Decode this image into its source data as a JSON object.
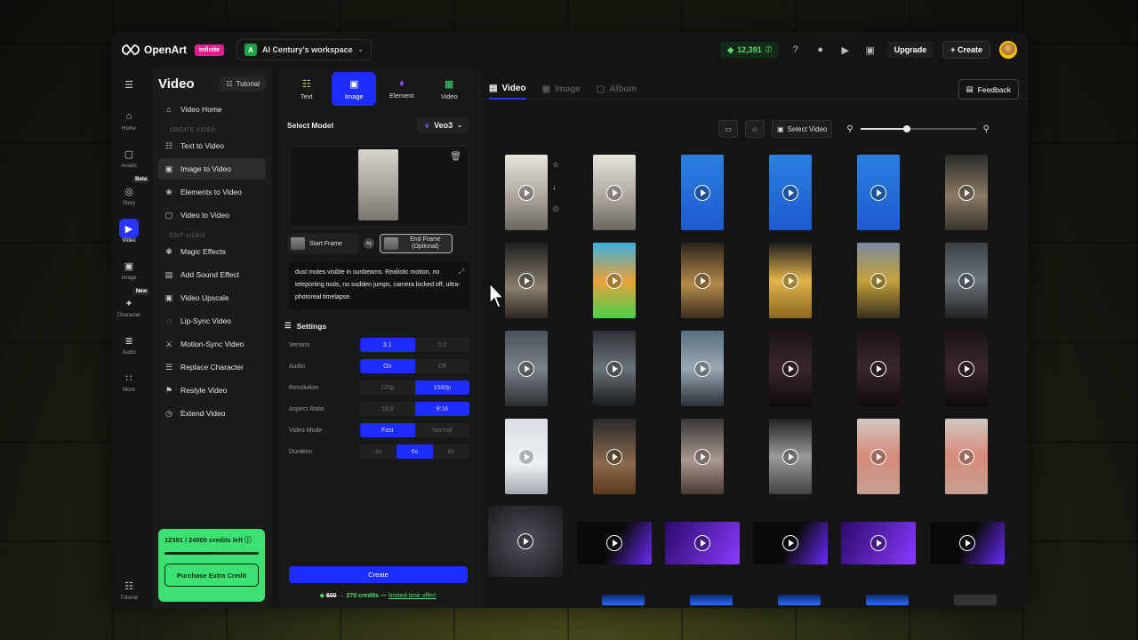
{
  "topbar": {
    "brand": "OpenArt",
    "plan_badge": "Infinite",
    "workspace_initial": "A",
    "workspace": "AI Century's workspace",
    "credits": "12,391",
    "upgrade": "Upgrade",
    "create": "Create"
  },
  "rail": [
    {
      "label": "Home",
      "icon": "home-icon"
    },
    {
      "label": "Assets",
      "icon": "folder-icon"
    },
    {
      "label": "Story",
      "icon": "story-icon",
      "badge": "Beta"
    },
    {
      "label": "Video",
      "icon": "video-icon",
      "active": true
    },
    {
      "label": "Image",
      "icon": "image-icon"
    },
    {
      "label": "Character",
      "icon": "character-icon",
      "badge": "New"
    },
    {
      "label": "Audio",
      "icon": "audio-icon"
    },
    {
      "label": "More",
      "icon": "more-icon"
    }
  ],
  "rail_bottom": {
    "label": "Tutorial"
  },
  "leftnav": {
    "title": "Video",
    "tutorial": "Tutorial",
    "home": "Video Home",
    "section_create": "CREATE VIDEO",
    "create_items": [
      "Text to Video",
      "Image to Video",
      "Elements to Video",
      "Video to Video"
    ],
    "section_edit": "EDIT VIDEO",
    "edit_items": [
      "Magic Effects",
      "Add Sound Effect",
      "Video Upscale",
      "Lip-Sync Video",
      "Motion-Sync Video",
      "Replace Character",
      "Restyle Video",
      "Extend Video"
    ]
  },
  "credits_box": {
    "text": "12391 / 24000 credits left",
    "used_fraction": 0.516,
    "button": "Purchase Extra Credit"
  },
  "mid": {
    "tabs": [
      "Text",
      "Image",
      "Element",
      "Video"
    ],
    "select_model": "Select Model",
    "model": "Veo3",
    "start_frame": "Start Frame",
    "end_frame": "End Frame (Optional)",
    "prompt": "dust motes visible in sunbeams. Realistic motion, no teleporting tools, no sudden jumps, camera locked off, ultra-photoreal timelapse.",
    "settings": "Settings",
    "rows": [
      {
        "label": "Version",
        "options": [
          "3.1",
          "3.0"
        ],
        "selected": 0
      },
      {
        "label": "Audio",
        "options": [
          "On",
          "Off"
        ],
        "selected": 0
      },
      {
        "label": "Resolution",
        "options": [
          "720p",
          "1080p"
        ],
        "selected": 1
      },
      {
        "label": "Aspect Ratio",
        "options": [
          "16:9",
          "9:16"
        ],
        "selected": 1
      },
      {
        "label": "Video Mode",
        "options": [
          "Fast",
          "Normal"
        ],
        "selected": 0
      },
      {
        "label": "Duration",
        "options": [
          "4s",
          "6s",
          "8s"
        ],
        "selected": 1
      }
    ],
    "create": "Create",
    "price_old": "600",
    "price_new": "270 credits",
    "offer_sep": "—",
    "offer_link": "limited-time offer!"
  },
  "gallery": {
    "tabs": [
      "Video",
      "Image",
      "Album"
    ],
    "feedback": "Feedback",
    "select_video": "Select Video",
    "zoom_level": 0.4
  }
}
